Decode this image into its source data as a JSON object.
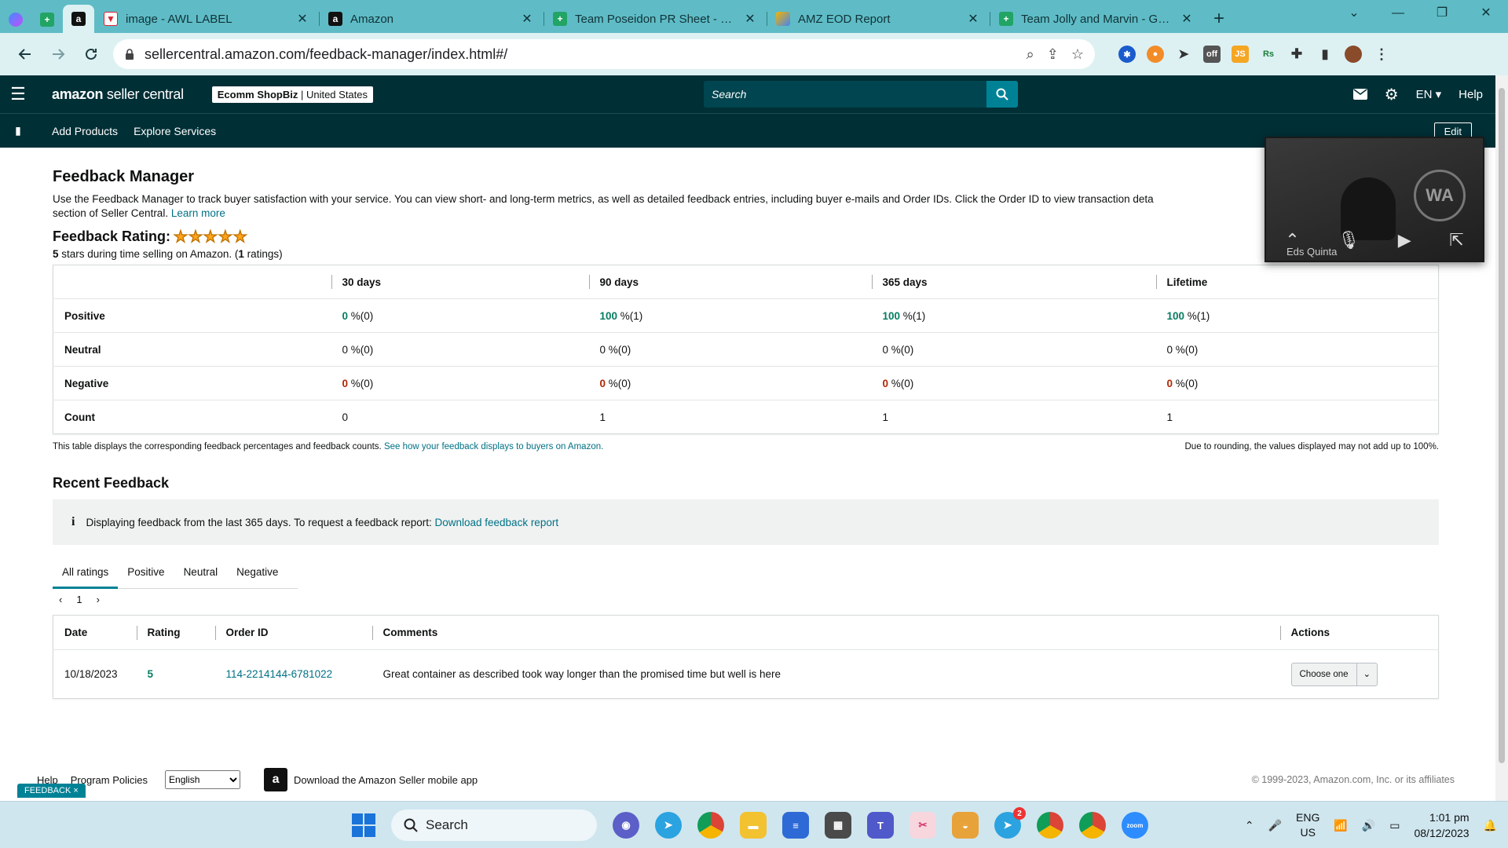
{
  "browser": {
    "tabs": [
      {
        "title": "image - AWL LABEL",
        "icon": "awl-label-favicon",
        "active": false
      },
      {
        "title": "Amazon",
        "icon": "amazon-favicon",
        "active": false
      },
      {
        "title": "Team Poseidon PR Sheet - Goo",
        "icon": "google-sheets-favicon",
        "active": false
      },
      {
        "title": "AMZ EOD Report",
        "icon": "eod-report-favicon",
        "active": false
      },
      {
        "title": "Team Jolly and Marvin - Goog",
        "icon": "google-sheets-favicon",
        "active": false
      }
    ],
    "url": "sellercentral.amazon.com/feedback-manager/index.html#/"
  },
  "header": {
    "logo_main": "amazon",
    "logo_sub": "seller central",
    "store_name": "Ecomm ShopBiz",
    "store_region": "United States",
    "search_placeholder": "Search",
    "lang": "EN",
    "help": "Help"
  },
  "subnav": {
    "items": [
      "Add Products",
      "Explore Services"
    ],
    "edit": "Edit"
  },
  "page": {
    "title": "Feedback Manager",
    "intro_text": "Use the Feedback Manager to track buyer satisfaction with your service. You can view short- and long-term metrics, as well as detailed feedback entries, including buyer e-mails and Order IDs. Click the Order ID to view transaction deta",
    "intro_text_2": "section of Seller Central.",
    "learn_more": "Learn more",
    "rating_label": "Feedback Rating:",
    "stars": "★★★★★",
    "rating_value": "5",
    "rating_text_1": " stars during time selling on Amazon. (",
    "rating_count": "1",
    "rating_text_2": " ratings)"
  },
  "metrics": {
    "columns": [
      "30 days",
      "90 days",
      "365 days",
      "Lifetime"
    ],
    "rows": [
      {
        "label": "Positive",
        "cells": [
          {
            "pct": "0",
            "rest": " %(0)"
          },
          {
            "pct": "100",
            "rest": " %(1)"
          },
          {
            "pct": "100",
            "rest": " %(1)"
          },
          {
            "pct": "100",
            "rest": " %(1)"
          }
        ]
      },
      {
        "label": "Neutral",
        "cells": [
          {
            "pct": "0",
            "rest": " %(0)"
          },
          {
            "pct": "0",
            "rest": " %(0)"
          },
          {
            "pct": "0",
            "rest": " %(0)"
          },
          {
            "pct": "0",
            "rest": " %(0)"
          }
        ]
      },
      {
        "label": "Negative",
        "cells": [
          {
            "pct": "0",
            "rest": " %(0)"
          },
          {
            "pct": "0",
            "rest": " %(0)"
          },
          {
            "pct": "0",
            "rest": " %(0)"
          },
          {
            "pct": "0",
            "rest": " %(0)"
          }
        ]
      }
    ],
    "count_label": "Count",
    "counts": [
      "0",
      "1",
      "1",
      "1"
    ],
    "note_left": "This table displays the corresponding feedback percentages and feedback counts.",
    "note_link": "See how your feedback displays to buyers on Amazon.",
    "note_right": "Due to rounding, the values displayed may not add up to 100%."
  },
  "recent": {
    "title": "Recent Feedback",
    "info_text": "Displaying feedback from the last 365 days. To request a feedback report:",
    "info_link": "Download feedback report",
    "tabs": [
      "All ratings",
      "Positive",
      "Neutral",
      "Negative"
    ],
    "page": "1",
    "columns": [
      "Date",
      "Rating",
      "Order ID",
      "Comments",
      "Actions"
    ],
    "rows": [
      {
        "date": "10/18/2023",
        "rating": "5",
        "order_id": "114-2214144-6781022",
        "comment": "Great container as described took way longer than the promised time but well is here",
        "action": "Choose one"
      }
    ]
  },
  "footer": {
    "help": "Help",
    "policies": "Program Policies",
    "language": "English",
    "app_text": "Download the Amazon Seller mobile app",
    "copyright": "© 1999-2023, Amazon.com, Inc. or its affiliates",
    "feedback_tab": "FEEDBACK ×"
  },
  "video": {
    "name": "Eds Quinta"
  },
  "taskbar": {
    "search": "Search",
    "lang_1": "ENG",
    "lang_2": "US",
    "time": "1:01 pm",
    "date": "08/12/2023",
    "telegram_badge": "2"
  },
  "colors": {
    "header_bg": "#002f36",
    "link": "#007185",
    "positive": "#067D62",
    "negative": "#B12704",
    "star": "#FFA41C"
  }
}
